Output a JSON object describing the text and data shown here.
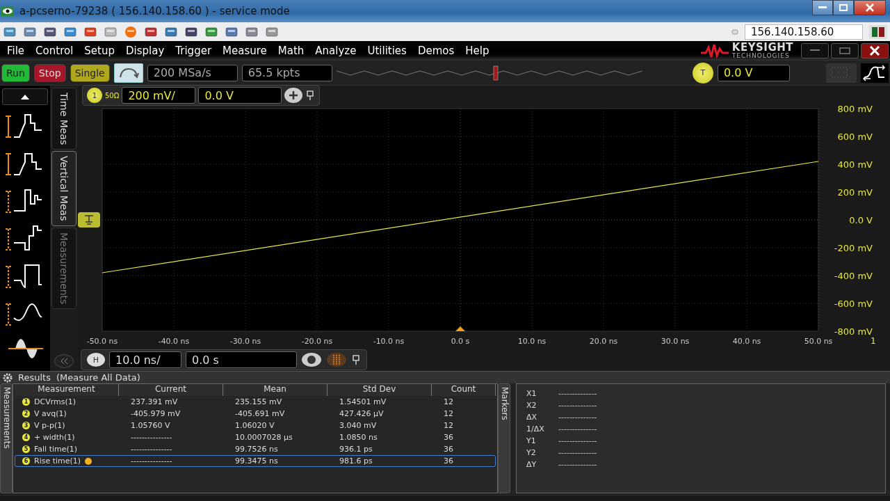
{
  "window": {
    "title": "a-pcserno-79238 ( 156.140.158.60 ) - service mode"
  },
  "remote_toolbar": {
    "address": "156.140.158.60"
  },
  "menu": [
    "File",
    "Control",
    "Setup",
    "Display",
    "Trigger",
    "Measure",
    "Math",
    "Analyze",
    "Utilities",
    "Demos",
    "Help"
  ],
  "logo": {
    "name": "KEYSIGHT",
    "subtitle": "TECHNOLOGIES"
  },
  "acquisition": {
    "buttons": [
      {
        "label": "Run",
        "color": "#22c43a"
      },
      {
        "label": "Stop",
        "color": "#b0182a"
      },
      {
        "label": "Single",
        "color": "#b8b020"
      }
    ],
    "sample_rate": "200 MSa/s",
    "memory_depth": "65.5 kpts",
    "trigger_badge": "T",
    "trigger_level": "0.0 V"
  },
  "side_tabs": [
    {
      "label": "Time Meas",
      "selected": false,
      "disabled": false
    },
    {
      "label": "Vertical Meas",
      "selected": true,
      "disabled": false
    },
    {
      "label": "Measurements",
      "selected": false,
      "disabled": true
    }
  ],
  "channel": {
    "number": "1",
    "impedance": "50Ω",
    "scale": "200 mV/",
    "offset": "0.0 V"
  },
  "plot": {
    "chart_data": {
      "type": "line",
      "grid": true,
      "x": [
        -50,
        50
      ],
      "series": [
        {
          "name": "1",
          "color": "#e8e840",
          "values": [
            -380,
            420
          ]
        }
      ],
      "xlim": [
        -50,
        50
      ],
      "ylim": [
        -800,
        800
      ],
      "xticks": [
        {
          "value": -50,
          "label": "-50.0 ns"
        },
        {
          "value": -40,
          "label": "-40.0 ns"
        },
        {
          "value": -30,
          "label": "-30.0 ns"
        },
        {
          "value": -20,
          "label": "-20.0 ns"
        },
        {
          "value": -10,
          "label": "-10.0 ns"
        },
        {
          "value": 0,
          "label": "0.0 s"
        },
        {
          "value": 10,
          "label": "10.0 ns"
        },
        {
          "value": 20,
          "label": "20.0 ns"
        },
        {
          "value": 30,
          "label": "30.0 ns"
        },
        {
          "value": 40,
          "label": "40.0 ns"
        },
        {
          "value": 50,
          "label": "50.0 ns"
        }
      ],
      "yticks": [
        {
          "value": 800,
          "label": "800 mV"
        },
        {
          "value": 600,
          "label": "600 mV"
        },
        {
          "value": 400,
          "label": "400 mV"
        },
        {
          "value": 200,
          "label": "200 mV"
        },
        {
          "value": 0,
          "label": "0.0 V"
        },
        {
          "value": -200,
          "label": "-200 mV"
        },
        {
          "value": -400,
          "label": "-400 mV"
        },
        {
          "value": -600,
          "label": "-600 mV"
        },
        {
          "value": -800,
          "label": "-800 mV"
        }
      ]
    }
  },
  "horizontal": {
    "badge": "H",
    "scale": "10.0 ns/",
    "position": "0.0 s"
  },
  "results": {
    "title": "Results",
    "subtitle": "(Measure All Data)",
    "side_label": "Measurements",
    "columns": [
      "Measurement",
      "Current",
      "Mean",
      "Std Dev",
      "Count"
    ],
    "rows": [
      {
        "index": "1",
        "name": "DCVrms(1)",
        "current": "237.391 mV",
        "mean": "235.155 mV",
        "std_dev": "1.54501 mV",
        "count": "12",
        "selected": false,
        "tracked": false
      },
      {
        "index": "2",
        "name": "V avq(1)",
        "current": "-405.979 mV",
        "mean": "-405.691 mV",
        "std_dev": "427.426 µV",
        "count": "12",
        "selected": false,
        "tracked": false
      },
      {
        "index": "3",
        "name": "V p-p(1)",
        "current": "1.05760 V",
        "mean": "1.06020 V",
        "std_dev": "3.040 mV",
        "count": "12",
        "selected": false,
        "tracked": false
      },
      {
        "index": "4",
        "name": "+ width(1)",
        "current": "---------------",
        "mean": "10.0007028 µs",
        "std_dev": "1.0850 ns",
        "count": "36",
        "selected": false,
        "tracked": false
      },
      {
        "index": "5",
        "name": "Fall time(1)",
        "current": "---------------",
        "mean": "99.7526 ns",
        "std_dev": "936.1 ps",
        "count": "36",
        "selected": false,
        "tracked": false
      },
      {
        "index": "6",
        "name": "Rise time(1)",
        "current": "---------------",
        "mean": "99.3475 ns",
        "std_dev": "981.6 ps",
        "count": "36",
        "selected": true,
        "tracked": true
      }
    ]
  },
  "markers": {
    "side_label": "Markers",
    "rows": [
      {
        "label": "X1",
        "value": "--------------"
      },
      {
        "label": "X2",
        "value": "--------------"
      },
      {
        "label": "ΔX",
        "value": "--------------"
      },
      {
        "label": "1/ΔX",
        "value": "--------------"
      },
      {
        "label": "Y1",
        "value": "--------------"
      },
      {
        "label": "Y2",
        "value": "--------------"
      },
      {
        "label": "ΔY",
        "value": "--------------"
      }
    ]
  }
}
